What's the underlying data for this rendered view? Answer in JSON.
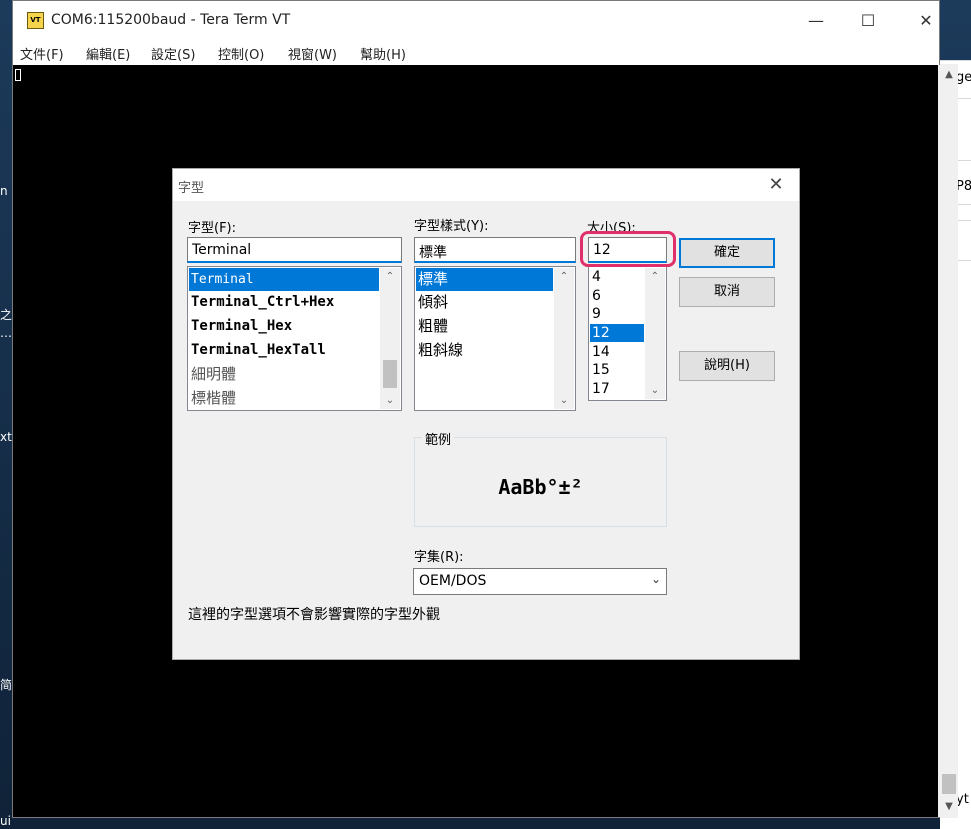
{
  "window": {
    "title": "COM6:115200baud - Tera Term VT",
    "icon_label": "VT",
    "controls": {
      "minimize": "—",
      "maximize": "☐",
      "close": "✕"
    }
  },
  "menubar": [
    "文件(F)",
    "編輯(E)",
    "設定(S)",
    "控制(O)",
    "視窗(W)",
    "幫助(H)"
  ],
  "dialog": {
    "title": "字型",
    "close_symbol": "✕",
    "font": {
      "label": "字型(F):",
      "value": "Terminal",
      "items": [
        "Terminal",
        "Terminal_Ctrl+Hex",
        "Terminal_Hex",
        "Terminal_HexTall",
        "細明體",
        "標楷體"
      ],
      "selected": "Terminal"
    },
    "style": {
      "label": "字型樣式(Y):",
      "value": "標準",
      "items": [
        "標準",
        "傾斜",
        "粗體",
        "粗斜線"
      ],
      "selected": "標準"
    },
    "size": {
      "label": "大小(S):",
      "value": "12",
      "items": [
        "4",
        "6",
        "9",
        "12",
        "14",
        "15",
        "17"
      ],
      "selected": "12"
    },
    "buttons": {
      "ok": "確定",
      "cancel": "取消",
      "help": "說明(H)"
    },
    "sample": {
      "label": "範例",
      "text": "AaBb°±²"
    },
    "charset": {
      "label": "字集(R):",
      "value": "OEM/DOS"
    },
    "note": "這裡的字型選項不會影響實際的字型外觀"
  },
  "desktop_fragments": [
    "n",
    "之",
    "…",
    "xt",
    "简",
    "ui)"
  ],
  "right_panel_fragments": [
    "ge",
    "P8",
    "yt"
  ],
  "colors": {
    "selection": "#0078d7",
    "highlight_ring": "#e0306a",
    "terminal_bg": "#000000"
  }
}
